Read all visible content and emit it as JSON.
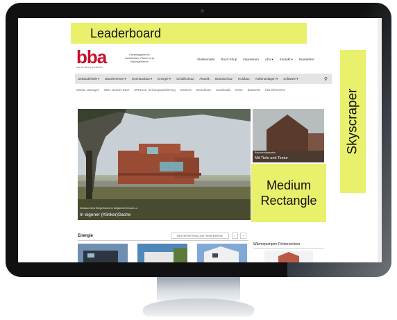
{
  "ads": {
    "leaderboard": "Leaderboard",
    "skyscraper": "Skyscraper",
    "medium_rectangle_line1": "Medium",
    "medium_rectangle_line2": "Rectangle"
  },
  "site": {
    "logo": "bba",
    "logo_sub": "bau beratung architektur",
    "tagline": "Fachmagazin für Architekten, Planer und Bauingenieure",
    "top_nav": [
      "Stellenmarkt",
      "Buch-Shop",
      "Impressum",
      "Abo ▾",
      "Kontakt ▾",
      "Newsletter"
    ],
    "categories": [
      "Gebäudehülle ▾",
      "Bauelemente ▾",
      "Innenausbau ▾",
      "Energie ▾",
      "Schallschutz",
      "Akustik",
      "Brandschutz",
      "Holzbau",
      "Außenanlagen ▾",
      "Software ▾"
    ],
    "sub_nav": [
      "Smarte Lösungen",
      "NEU: Dossier Dach",
      "SPECIAL: Heizungsoptimierung",
      "Dossiers",
      "Broschüren",
      "Downloads",
      "News",
      "Bauwerke",
      "bba-Infoservice"
    ]
  },
  "hero": {
    "main_kicker": "Neubau eines Bürgerbüros im belgischen Kessel-Lo",
    "main_title": "In eigener (Klinker)Sache",
    "side_kicker": "Backsteinfassaden",
    "side_title": "Mit Tiefe und Textur"
  },
  "section": {
    "title": "Energie",
    "more_label": "WEITERE BEITRÄGE ZUM THEMA ENERGIE",
    "prev": "‹",
    "next": "›",
    "widget_title": "Wärmepumpen-Förderrechner"
  },
  "colors": {
    "ad_placeholder": "#e8f06c",
    "logo_red": "#c8102e",
    "category_bar": "#e4e4e4"
  },
  "icons": {
    "search": "search-icon"
  }
}
